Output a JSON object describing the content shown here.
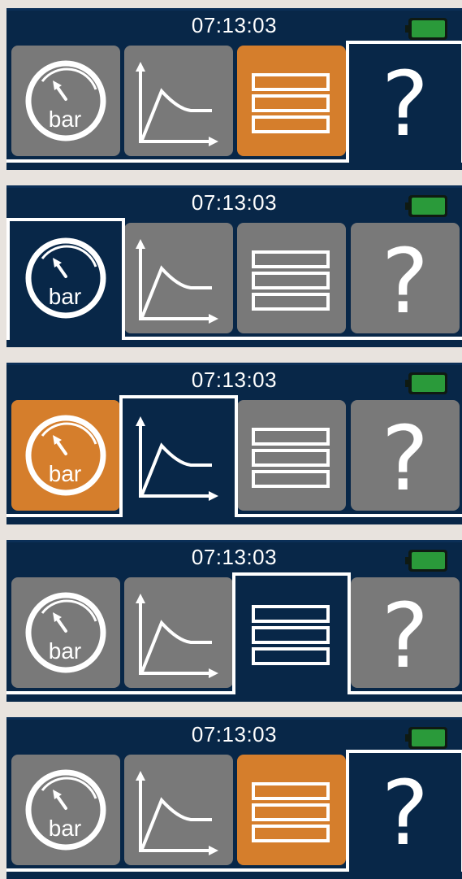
{
  "screens": [
    {
      "time": "07:13:03",
      "active": 3,
      "highlight": 2
    },
    {
      "time": "07:13:03",
      "active": 0,
      "highlight": -1
    },
    {
      "time": "07:13:03",
      "active": 1,
      "highlight": 0
    },
    {
      "time": "07:13:03",
      "active": 2,
      "highlight": -1
    },
    {
      "time": "07:13:03",
      "active": 3,
      "highlight": 2
    }
  ],
  "tiles": [
    {
      "name": "pressure-gauge-tile",
      "icon": "pressure-gauge-icon",
      "label": "bar"
    },
    {
      "name": "pressure-curve-tile",
      "icon": "line-chart-icon",
      "label": ""
    },
    {
      "name": "menu-list-tile",
      "icon": "list-menu-icon",
      "label": ""
    },
    {
      "name": "help-tile",
      "icon": "question-mark-icon",
      "label": "?"
    }
  ],
  "battery": {
    "icon": "battery-icon",
    "color": "#2a9a3a"
  },
  "colors": {
    "background": "#082748",
    "tile": "#797979",
    "selected": "#d57e2c",
    "line": "#ffffff"
  }
}
